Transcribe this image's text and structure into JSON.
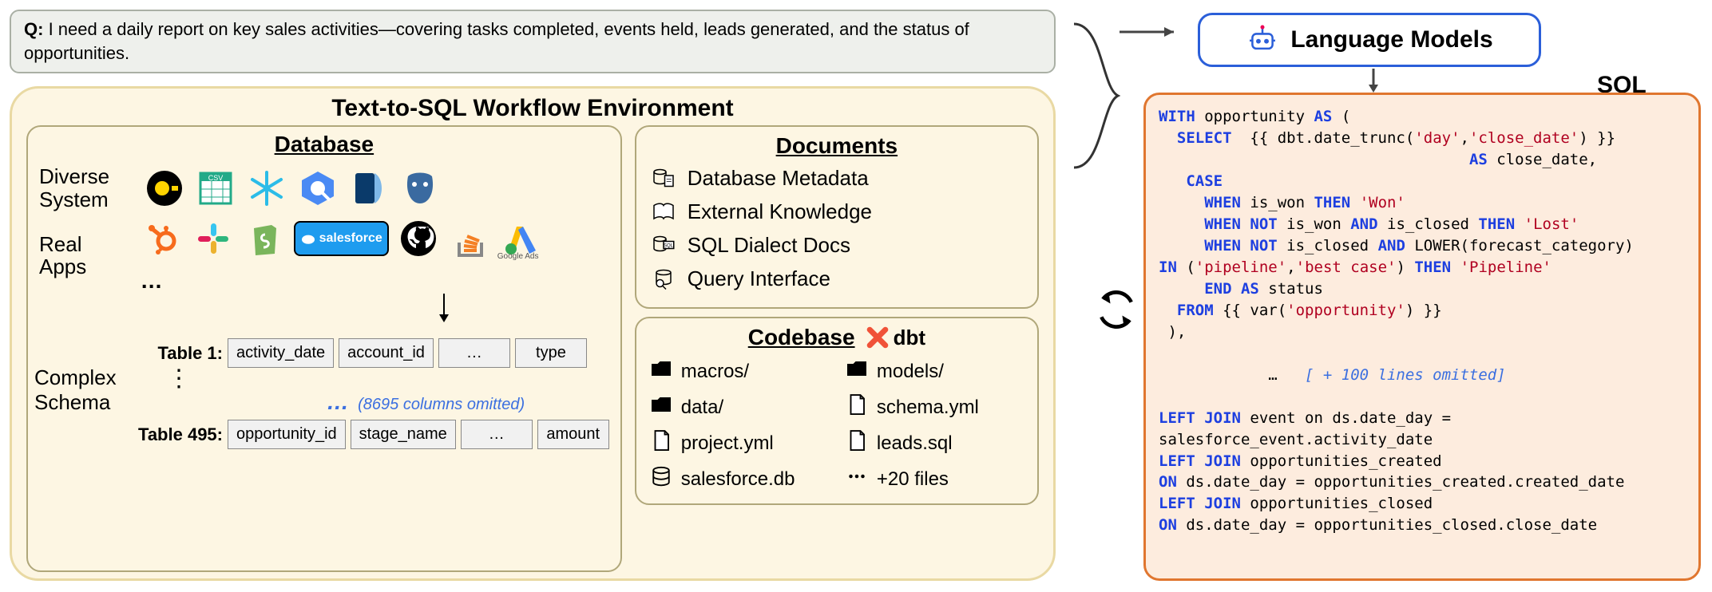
{
  "query": {
    "prefix": "Q:",
    "text": "I need a daily report on key sales activities—covering tasks completed, events held, leads generated, and the status of opportunities."
  },
  "env": {
    "title": "Text-to-SQL Workflow Environment",
    "database": {
      "title": "Database",
      "diverse_label": "Diverse\nSystem",
      "apps_label": "Real\nApps",
      "schema_label": "Complex\nSchema",
      "system_icons": [
        "duckdb",
        "csv",
        "snowflake",
        "bigquery",
        "sqlite",
        "postgres"
      ],
      "app_icons": [
        "hubspot",
        "slack",
        "shopify",
        "salesforce",
        "github",
        "stackoverflow",
        "google-ads"
      ],
      "apps_more": "…",
      "salesforce_label": "salesforce",
      "table1": {
        "label": "Table 1:",
        "cols": [
          "activity_date",
          "account_id",
          "…",
          "type"
        ]
      },
      "omitted_cols": "(8695 columns omitted)",
      "table495": {
        "label": "Table 495:",
        "cols": [
          "opportunity_id",
          "stage_name",
          "…",
          "amount"
        ]
      }
    },
    "documents": {
      "title": "Documents",
      "items": [
        "Database Metadata",
        "External Knowledge",
        "SQL Dialect Docs",
        "Query Interface"
      ],
      "icons": [
        "db-doc",
        "book",
        "sql-doc",
        "search-db"
      ]
    },
    "codebase": {
      "title": "Codebase",
      "tool": "dbt",
      "files": [
        {
          "icon": "folder",
          "name": "macros/"
        },
        {
          "icon": "folder",
          "name": "models/"
        },
        {
          "icon": "folder",
          "name": "data/"
        },
        {
          "icon": "file",
          "name": "schema.yml"
        },
        {
          "icon": "file",
          "name": "project.yml"
        },
        {
          "icon": "file",
          "name": "leads.sql"
        },
        {
          "icon": "db",
          "name": "salesforce.db"
        },
        {
          "icon": "more",
          "name": "+20 files"
        }
      ]
    }
  },
  "lm": {
    "title": "Language Models"
  },
  "sql": {
    "title": "SQL",
    "code_tokens": [
      {
        "t": "kw",
        "v": "WITH"
      },
      {
        "v": " opportunity "
      },
      {
        "t": "kw",
        "v": "AS"
      },
      {
        "v": " (\n  "
      },
      {
        "t": "kw",
        "v": "SELECT"
      },
      {
        "v": "  {{ dbt.date_trunc("
      },
      {
        "t": "str",
        "v": "'day'"
      },
      {
        "v": ","
      },
      {
        "t": "str",
        "v": "'close_date'"
      },
      {
        "v": ") }}\n                                  "
      },
      {
        "t": "kw",
        "v": "AS"
      },
      {
        "v": " close_date,\n   "
      },
      {
        "t": "kw",
        "v": "CASE"
      },
      {
        "v": "\n     "
      },
      {
        "t": "kw",
        "v": "WHEN"
      },
      {
        "v": " is_won "
      },
      {
        "t": "kw",
        "v": "THEN"
      },
      {
        "v": " "
      },
      {
        "t": "str",
        "v": "'Won'"
      },
      {
        "v": "\n     "
      },
      {
        "t": "kw",
        "v": "WHEN NOT"
      },
      {
        "v": " is_won "
      },
      {
        "t": "kw",
        "v": "AND"
      },
      {
        "v": " is_closed "
      },
      {
        "t": "kw",
        "v": "THEN"
      },
      {
        "v": " "
      },
      {
        "t": "str",
        "v": "'Lost'"
      },
      {
        "v": "\n     "
      },
      {
        "t": "kw",
        "v": "WHEN NOT"
      },
      {
        "v": " is_closed "
      },
      {
        "t": "kw",
        "v": "AND"
      },
      {
        "v": " LOWER(forecast_category)\n"
      },
      {
        "t": "kw",
        "v": "IN"
      },
      {
        "v": " ("
      },
      {
        "t": "str",
        "v": "'pipeline'"
      },
      {
        "v": ","
      },
      {
        "t": "str",
        "v": "'best case'"
      },
      {
        "v": ") "
      },
      {
        "t": "kw",
        "v": "THEN"
      },
      {
        "v": " "
      },
      {
        "t": "str",
        "v": "'Pipeline'"
      },
      {
        "v": "\n     "
      },
      {
        "t": "kw",
        "v": "END AS"
      },
      {
        "v": " status\n  "
      },
      {
        "t": "kw",
        "v": "FROM"
      },
      {
        "v": " {{ var("
      },
      {
        "t": "str",
        "v": "'opportunity'"
      },
      {
        "v": ") }}\n ),\n\n            "
      },
      {
        "t": "plain",
        "v": "…   "
      },
      {
        "t": "omit",
        "v": "[ + 100 lines omitted]"
      },
      {
        "v": "\n\n"
      },
      {
        "t": "kw",
        "v": "LEFT JOIN"
      },
      {
        "v": " event on ds.date_day =\nsalesforce_event.activity_date\n"
      },
      {
        "t": "kw",
        "v": "LEFT JOIN"
      },
      {
        "v": " opportunities_created\n"
      },
      {
        "t": "kw",
        "v": "ON"
      },
      {
        "v": " ds.date_day = opportunities_created.created_date\n"
      },
      {
        "t": "kw",
        "v": "LEFT JOIN"
      },
      {
        "v": " opportunities_closed\n"
      },
      {
        "t": "kw",
        "v": "ON"
      },
      {
        "v": " ds.date_day = opportunities_closed.close_date"
      }
    ]
  }
}
